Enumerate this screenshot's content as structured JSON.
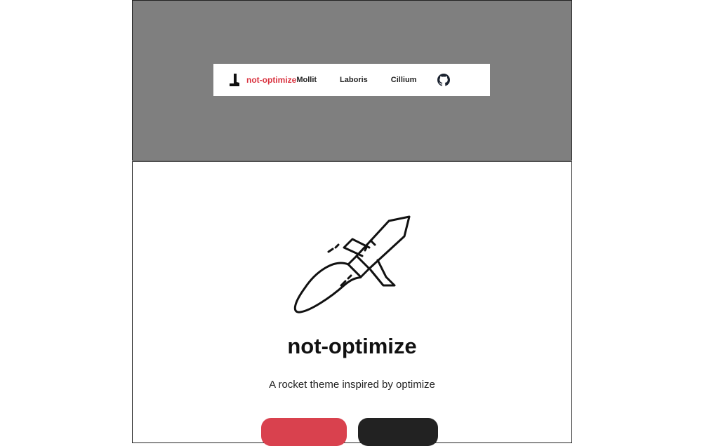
{
  "navbar": {
    "brand_name": "not-optimize",
    "links": [
      {
        "label": "Mollit"
      },
      {
        "label": "Laboris"
      },
      {
        "label": "Cillium"
      }
    ],
    "github_icon": "github-icon",
    "logo_icon": "boot-logo-icon"
  },
  "hero": {
    "illustration_icon": "rocket-icon",
    "title": "not-optimize",
    "subtitle": "A rocket theme inspired by optimize"
  },
  "colors": {
    "brand": "#d9313e",
    "preview_background": "#7f7f7f",
    "primary_button": "#d9414e",
    "secondary_button": "#222222"
  }
}
